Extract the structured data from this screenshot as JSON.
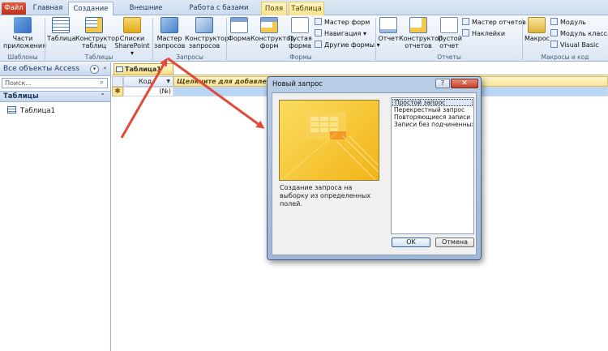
{
  "ribbon_tabs": [
    "Файл",
    "Главная",
    "Создание",
    "Внешние данные",
    "Работа с базами данных",
    "Поля",
    "Таблица"
  ],
  "ribbon": {
    "parts": "Части\nприложения",
    "table": "Таблица",
    "table_design": "Конструктор\nтаблиц",
    "sharepoint": "Списки\nSharePoint ▾",
    "query_wizard": "Мастер\nзапросов",
    "query_design": "Конструктор\nзапросов",
    "form": "Форма",
    "form_design": "Конструктор\nформ",
    "blank_form": "Пустая\nформа",
    "form_wizard": "Мастер форм",
    "navigation": "Навигация ▾",
    "other_forms": "Другие формы ▾",
    "report": "Отчет",
    "report_design": "Конструктор\nотчетов",
    "blank_report": "Пустой\nотчет",
    "report_wizard": "Мастер отчетов",
    "labels": "Наклейки",
    "macro": "Макрос",
    "module": "Модуль",
    "class_module": "Модуль класса",
    "visual_basic": "Visual Basic",
    "groups": {
      "templates": "Шаблоны",
      "tables": "Таблицы",
      "queries": "Запросы",
      "forms": "Формы",
      "reports": "Отчеты",
      "macros": "Макросы и код"
    }
  },
  "nav": {
    "title": "Все объекты Access",
    "search_placeholder": "Поиск...",
    "section": "Таблицы",
    "item": "Таблица1"
  },
  "doc": {
    "tab_label": "Таблица1",
    "col_code": "Код",
    "col_add": "Щелкните для добавления",
    "new_row_value": "(№)"
  },
  "dialog": {
    "title": "Новый запрос",
    "help": "?",
    "close": "✕",
    "description": "Создание запроса на выборку из определенных полей.",
    "options": [
      "Простой запрос",
      "Перекрестный запрос",
      "Повторяющиеся записи",
      "Записи без подчиненных"
    ],
    "ok": "OK",
    "cancel": "Отмена"
  }
}
